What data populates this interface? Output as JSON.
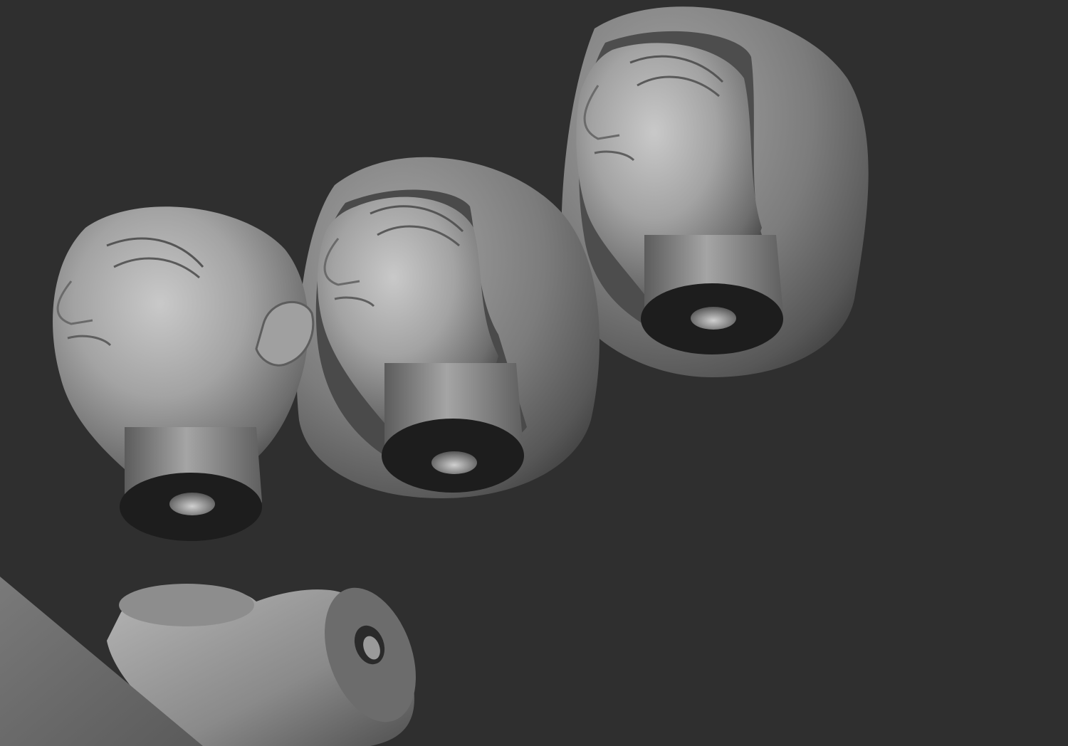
{
  "viewport": {
    "background_color": "#2f2f2f"
  },
  "scene": {
    "material_color": "#8f8f8f",
    "shadow_color": "#1b1b1b",
    "objects": [
      "bald-head-with-neck-peg",
      "head-with-medium-headdress",
      "head-with-large-headdress",
      "neck-peg-piece"
    ]
  }
}
